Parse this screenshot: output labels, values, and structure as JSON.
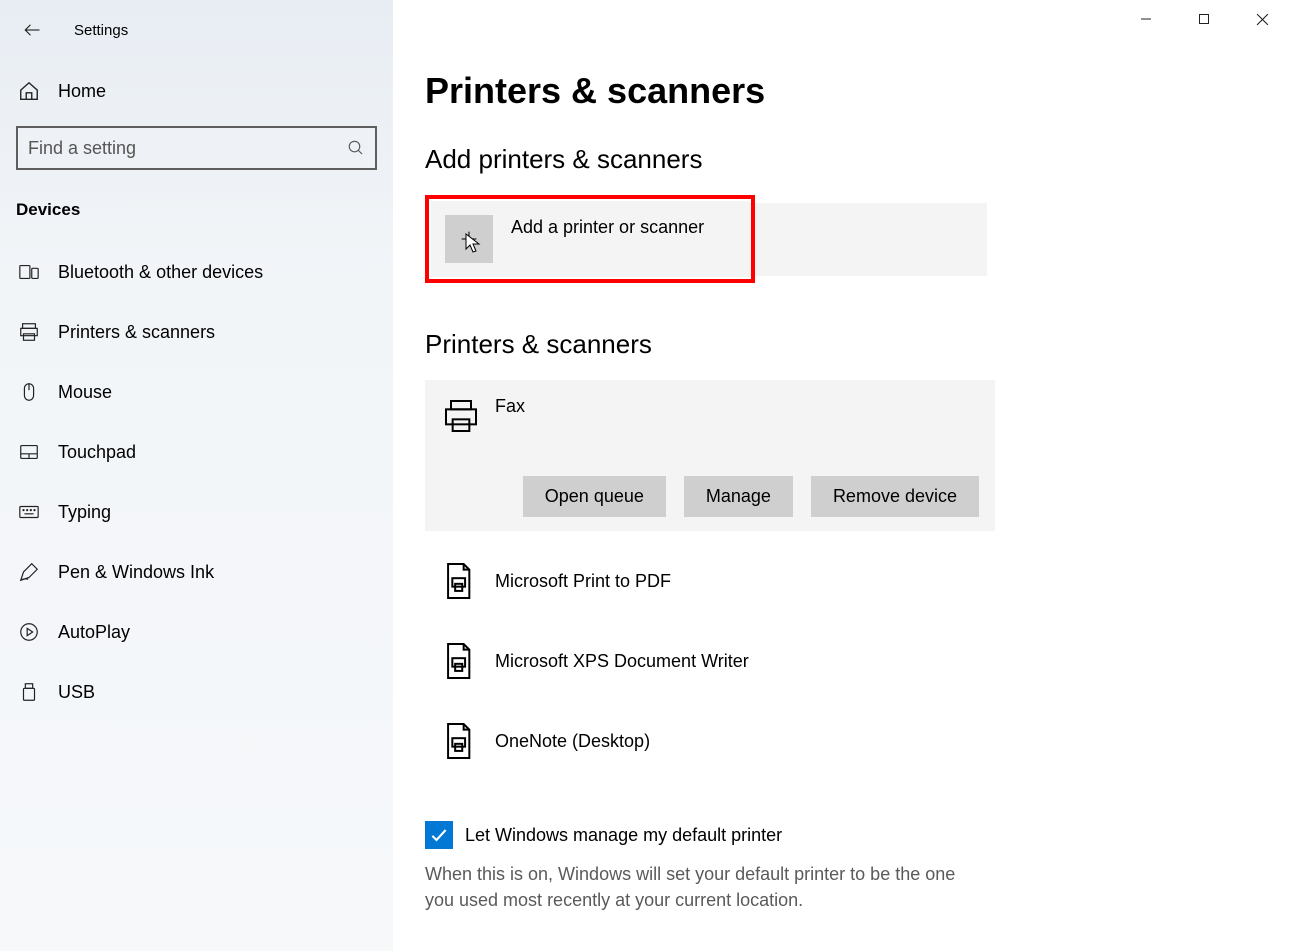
{
  "app": {
    "title": "Settings"
  },
  "sidebar": {
    "home": "Home",
    "search_placeholder": "Find a setting",
    "category": "Devices",
    "items": [
      {
        "label": "Bluetooth & other devices"
      },
      {
        "label": "Printers & scanners"
      },
      {
        "label": "Mouse"
      },
      {
        "label": "Touchpad"
      },
      {
        "label": "Typing"
      },
      {
        "label": "Pen & Windows Ink"
      },
      {
        "label": "AutoPlay"
      },
      {
        "label": "USB"
      }
    ]
  },
  "main": {
    "title": "Printers & scanners",
    "add_section": "Add printers & scanners",
    "add_label": "Add a printer or scanner",
    "list_section": "Printers & scanners",
    "selected_printer": {
      "name": "Fax",
      "actions": {
        "open_queue": "Open queue",
        "manage": "Manage",
        "remove": "Remove device"
      }
    },
    "printers": [
      {
        "name": "Microsoft Print to PDF"
      },
      {
        "name": "Microsoft XPS Document Writer"
      },
      {
        "name": "OneNote (Desktop)"
      }
    ],
    "default_check": "Let Windows manage my default printer",
    "default_desc": "When this is on, Windows will set your default printer to be the one you used most recently at your current location."
  }
}
